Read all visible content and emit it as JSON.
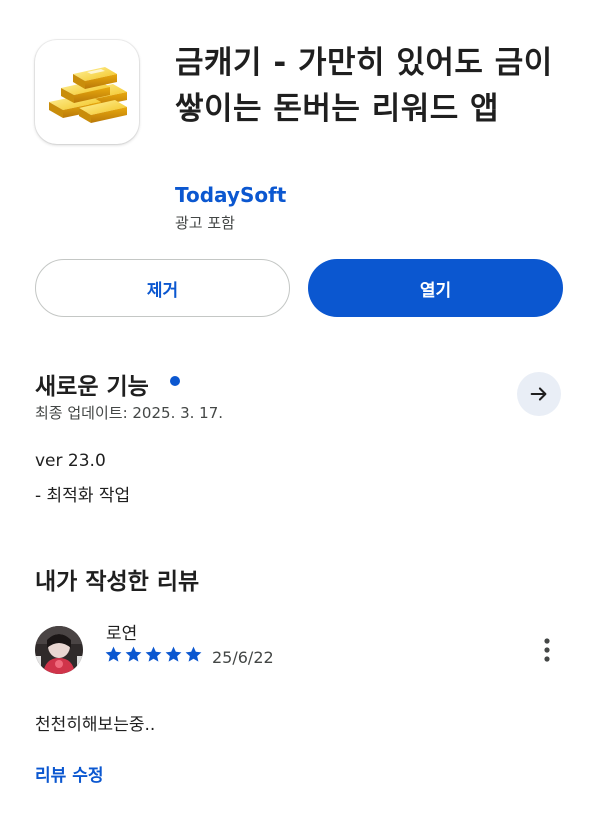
{
  "app": {
    "title": "금캐기 - 가만히 있어도 금이 쌓이는 돈버는 리워드 앱",
    "developer": "TodaySoft",
    "ads_label": "광고 포함",
    "icon": "gold-bars-icon"
  },
  "actions": {
    "uninstall_label": "제거",
    "open_label": "열기"
  },
  "whats_new": {
    "title": "새로운 기능",
    "last_updated": "최종 업데이트: 2025. 3. 17.",
    "version": "ver 23.0",
    "note": "- 최적화 작업",
    "arrow_icon": "arrow-right-icon"
  },
  "my_review": {
    "title": "내가 작성한 리뷰",
    "reviewer_name": "로연",
    "rating": 5,
    "max_rating": 5,
    "date": "25/6/22",
    "text": "천천히해보는중..",
    "edit_label": "리뷰 수정",
    "more_icon": "more-vert-icon"
  },
  "colors": {
    "accent": "#0b57d0",
    "text_primary": "#1f1f1f",
    "text_secondary": "#444746",
    "outline": "#c4c7c5",
    "arrow_bg": "#e9eef6"
  }
}
